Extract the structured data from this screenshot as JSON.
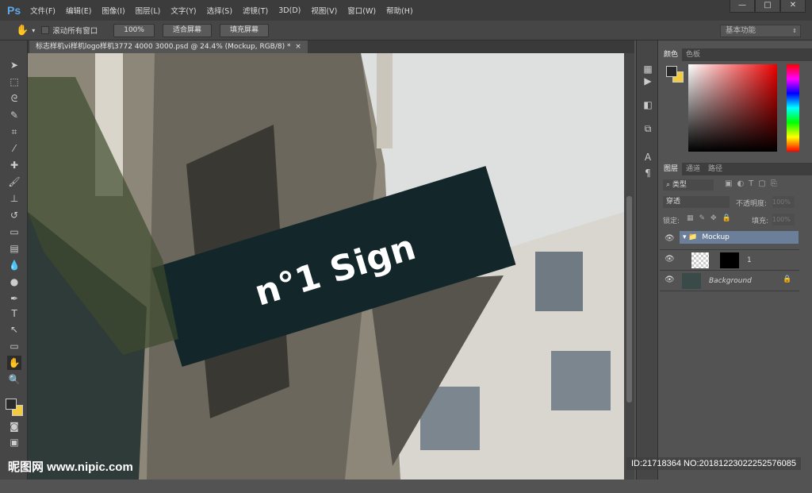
{
  "app": {
    "logo": "Ps"
  },
  "menu": [
    "文件(F)",
    "编辑(E)",
    "图像(I)",
    "图层(L)",
    "文字(Y)",
    "选择(S)",
    "滤镜(T)",
    "3D(D)",
    "视图(V)",
    "窗口(W)",
    "帮助(H)"
  ],
  "window_controls": {
    "minimize": "—",
    "maximize": "□",
    "close": "✕"
  },
  "options": {
    "scroll_all": "滚动所有窗口",
    "zoom_100": "100%",
    "fit_screen": "适合屏幕",
    "fill_screen": "填充屏幕",
    "workspace": "基本功能"
  },
  "document": {
    "tab_title": "标志样机vi样机logo样机3772 4000 3000.psd @ 24.4% (Mockup, RGB/8) *",
    "close": "×",
    "sign_text": "n°1 Sign"
  },
  "color_panel": {
    "tabs": [
      "颜色",
      "色板"
    ],
    "foreground": "#2a2a2a",
    "background": "#f2cc3c"
  },
  "layers_panel": {
    "tabs": [
      "图层",
      "通道",
      "路径"
    ],
    "filter_label": "类型",
    "blend_mode": "穿透",
    "opacity_label": "不透明度:",
    "opacity": "100%",
    "lock_label": "锁定:",
    "fill_label": "填充:",
    "fill": "100%",
    "layers": [
      {
        "name": "Mockup",
        "type": "group",
        "selected": true
      },
      {
        "name": "1",
        "type": "smart"
      },
      {
        "name": "Background",
        "type": "image",
        "locked": true
      }
    ]
  },
  "watermark": {
    "site": "昵图网 www.nipic.com",
    "id": "ID:21718364 NO:20181223022252576085"
  }
}
